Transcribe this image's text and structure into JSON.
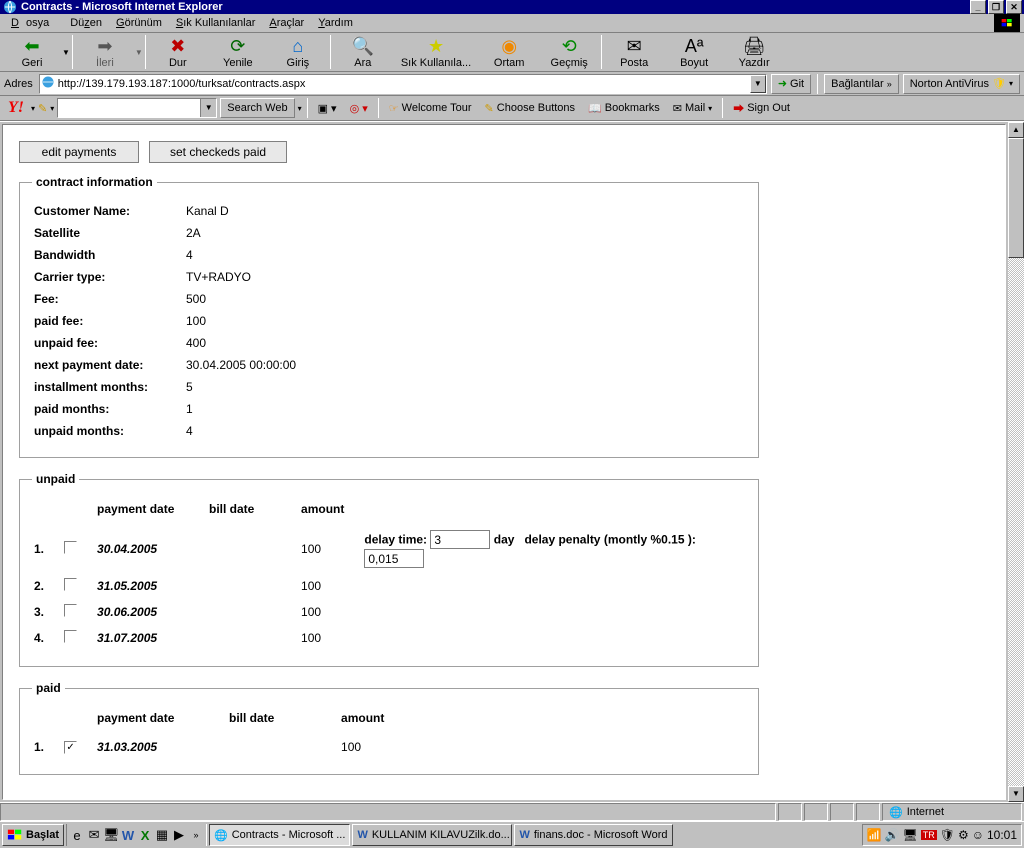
{
  "window": {
    "title": "Contracts - Microsoft Internet Explorer"
  },
  "menubar": {
    "items": [
      "Dosya",
      "Düzen",
      "Görünüm",
      "Sık Kullanılanlar",
      "Araçlar",
      "Yardım"
    ]
  },
  "navbar": {
    "back": "Geri",
    "forward": "İleri",
    "stop": "Dur",
    "refresh": "Yenile",
    "home": "Giriş",
    "search": "Ara",
    "favorites": "Sık Kullanıla...",
    "media": "Ortam",
    "history": "Geçmiş",
    "mail": "Posta",
    "size": "Boyut",
    "print": "Yazdır"
  },
  "address": {
    "label": "Adres",
    "url": "http://139.179.193.187:1000/turksat/contracts.aspx",
    "go": "Git",
    "links": "Bağlantılar",
    "norton": "Norton AntiVirus"
  },
  "yahoo": {
    "search_btn": "Search Web",
    "welcome": "Welcome Tour",
    "choose": "Choose Buttons",
    "bookmarks": "Bookmarks",
    "mail": "Mail",
    "signout": "Sign Out"
  },
  "page": {
    "btn_edit": "edit payments",
    "btn_setpaid": "set checkeds paid",
    "legend_info": "contract information",
    "legend_unpaid": "unpaid",
    "legend_paid": "paid",
    "info_labels": {
      "customer": "Customer Name:",
      "satellite": "Satellite",
      "bandwidth": "Bandwidth",
      "carrier": "Carrier type:",
      "fee": "Fee:",
      "paidfee": "paid fee:",
      "unpaidfee": "unpaid fee:",
      "nextpay": "next payment date:",
      "inst": "installment months:",
      "paidm": "paid months:",
      "unpaidm": "unpaid months:"
    },
    "info_values": {
      "customer": "Kanal D",
      "satellite": "2A",
      "bandwidth": "4",
      "carrier": "TV+RADYO",
      "fee": "500",
      "paidfee": "100",
      "unpaidfee": "400",
      "nextpay": "30.04.2005 00:00:00",
      "inst": "5",
      "paidm": "1",
      "unpaidm": "4"
    },
    "headers": {
      "pdate": "payment date",
      "bdate": "bill date",
      "amount": "amount"
    },
    "unpaid": [
      {
        "idx": "1.",
        "pdate": "30.04.2005",
        "bdate": "",
        "amount": "100"
      },
      {
        "idx": "2.",
        "pdate": "31.05.2005",
        "bdate": "",
        "amount": "100"
      },
      {
        "idx": "3.",
        "pdate": "30.06.2005",
        "bdate": "",
        "amount": "100"
      },
      {
        "idx": "4.",
        "pdate": "31.07.2005",
        "bdate": "",
        "amount": "100"
      }
    ],
    "paid": [
      {
        "idx": "1.",
        "pdate": "31.03.2005",
        "bdate": "",
        "amount": "100",
        "checked": true
      }
    ],
    "delay": {
      "label_time": "delay time:",
      "val_time": "3",
      "day": "day",
      "label_penalty": "delay penalty (montly %0.15 ):",
      "val_penalty": "0,015"
    }
  },
  "statusbar": {
    "zone": "Internet"
  },
  "taskbar": {
    "start": "Başlat",
    "tasks": [
      {
        "label": "Contracts - Microsoft ...",
        "icon": "ie",
        "active": true
      },
      {
        "label": "KULLANIM KILAVUZilk.do...",
        "icon": "word",
        "active": false
      },
      {
        "label": "finans.doc - Microsoft Word",
        "icon": "word",
        "active": false
      }
    ],
    "clock": "10:01"
  }
}
